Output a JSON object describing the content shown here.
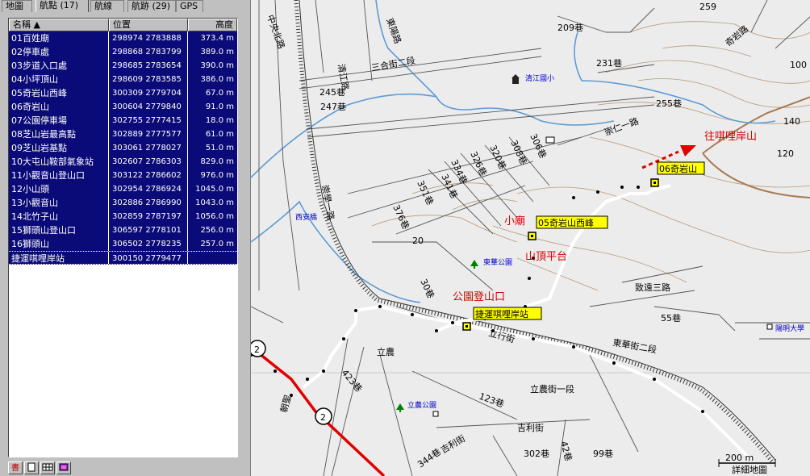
{
  "tabs": [
    {
      "label": "地圖"
    },
    {
      "label": "航點 (17)"
    },
    {
      "label": "航線"
    },
    {
      "label": "航跡 (29)"
    },
    {
      "label": "GPS"
    }
  ],
  "list": {
    "headers": [
      "名稱",
      "位置",
      "高度"
    ],
    "rows": [
      {
        "name": "01百姓廟",
        "pos": "298974 2783888",
        "alt": "373.4 m"
      },
      {
        "name": "02停車處",
        "pos": "298868 2783799",
        "alt": "389.0 m"
      },
      {
        "name": "03步道入口處",
        "pos": "298685 2783654",
        "alt": "390.0 m"
      },
      {
        "name": "04小坪頂山",
        "pos": "298609 2783585",
        "alt": "386.0 m"
      },
      {
        "name": "05奇岩山西峰",
        "pos": "300309 2779704",
        "alt": "67.0 m"
      },
      {
        "name": "06奇岩山",
        "pos": "300604 2779840",
        "alt": "91.0 m"
      },
      {
        "name": "07公園停車場",
        "pos": "302755 2777415",
        "alt": "18.0 m"
      },
      {
        "name": "08芝山岩最高點",
        "pos": "302889 2777577",
        "alt": "61.0 m"
      },
      {
        "name": "09芝山岩基點",
        "pos": "303061 2778027",
        "alt": "51.0 m"
      },
      {
        "name": "10大屯山鞍部氣象站",
        "pos": "302607 2786303",
        "alt": "829.0 m"
      },
      {
        "name": "11小觀音山登山口",
        "pos": "303122 2786602",
        "alt": "976.0 m"
      },
      {
        "name": "12小山頭",
        "pos": "302954 2786924",
        "alt": "1045.0 m"
      },
      {
        "name": "13小觀音山",
        "pos": "302886 2786990",
        "alt": "1043.0 m"
      },
      {
        "name": "14北竹子山",
        "pos": "302859 2787197",
        "alt": "1056.0 m"
      },
      {
        "name": "15獅頭山登山口",
        "pos": "306597 2778101",
        "alt": "256.0 m"
      },
      {
        "name": "16獅頭山",
        "pos": "306502 2778235",
        "alt": "257.0 m"
      },
      {
        "name": "捷運唭哩岸站",
        "pos": "300150 2779477",
        "alt": ""
      }
    ]
  },
  "bottom_icons": [
    "tool-book-icon",
    "tool-page-icon",
    "tool-grid-icon",
    "tool-color-icon"
  ],
  "map": {
    "waypoints": {
      "w06": "06奇岩山",
      "w05": "05奇岩山西峰",
      "station": "捷運唭哩岸站"
    },
    "annotations": {
      "to_qilian": "往唭哩岸山",
      "xiaomiao": "小廟",
      "peak_platform": "山頂平台",
      "park_trailhead": "公園登山口"
    },
    "roads": {
      "r209": "209巷",
      "r231": "231巷",
      "r255": "255巷",
      "r245": "245巷",
      "r247": "247巷",
      "r259": "259",
      "qiyan_road": "奇岩路",
      "chongren1": "崇仁一路",
      "sanhe": "三合街二段",
      "qingjiang": "清江路",
      "dongyang": "東陽路",
      "chongxue": "崇學一路",
      "r306": "306巷",
      "r308": "308巷",
      "r320": "320巷",
      "r326": "326巷",
      "r334": "334巷",
      "r341": "341巷",
      "r351": "351巷",
      "r376": "376巷",
      "r30": "30巷",
      "zhiyuan3": "致遠三路",
      "r55": "55巷",
      "donghua2": "東華街二段",
      "lixing": "立行街",
      "linong1": "立農街一段",
      "linong": "立農",
      "r123": "123巷",
      "jili": "吉利街",
      "r302": "302巷",
      "r42": "42巷",
      "r99": "99巷",
      "r344": "344巷",
      "r423": "423巷",
      "r20": "20",
      "r140": "140",
      "r120": "120",
      "r100": "100",
      "chaoyuan": "朝聖",
      "school": "清江國小",
      "park1": "東華公園",
      "park2": "立農公園",
      "univ": "陽明大學",
      "xian": "西安橋",
      "scale": "200 m",
      "detail": "詳細地圖",
      "route2": "2",
      "route2b": "2",
      "zhongyang": "中央北路"
    }
  }
}
